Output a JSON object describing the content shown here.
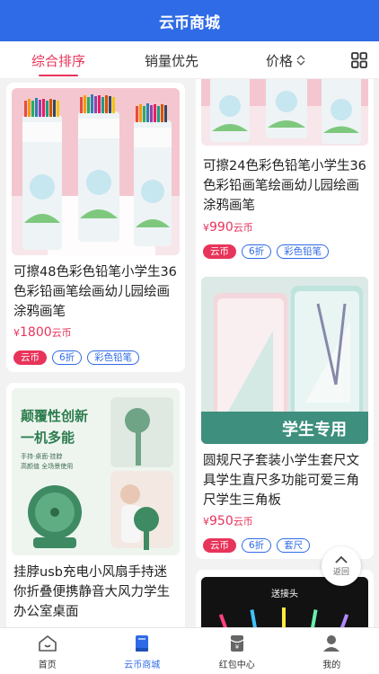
{
  "header": {
    "title": "云币商城"
  },
  "tabs": [
    {
      "label": "综合排序",
      "active": true
    },
    {
      "label": "销量优先",
      "active": false
    },
    {
      "label": "价格",
      "active": false
    }
  ],
  "grid_toggle_icon": "grid-icon",
  "products": [
    {
      "title": "可擦48色彩色铅笔小学生36色彩铅画笔绘画幼儿园绘画涂鸦画笔",
      "price_symbol": "¥",
      "price": "1800",
      "price_unit": "云币",
      "tags": [
        "云币",
        "6折",
        "彩色铅笔"
      ]
    },
    {
      "title": "可擦24色彩色铅笔小学生36色彩铅画笔绘画幼儿园绘画涂鸦画笔",
      "price_symbol": "¥",
      "price": "990",
      "price_unit": "云币",
      "tags": [
        "云币",
        "6折",
        "彩色铅笔"
      ]
    },
    {
      "title": "挂脖usb充电小风扇手持迷你折叠便携静音大风力学生办公室桌面",
      "price_symbol": "¥",
      "price": "",
      "price_unit": "",
      "tags": [],
      "image_text": {
        "line1": "颠覆性创新",
        "line2": "一机多能",
        "line3": "手持·桌面·挂脖",
        "line4": "高颜值 全场景使用"
      }
    },
    {
      "title": "圆规尺子套装小学生套尺文具学生直尺多功能可爱三角尺学生三角板",
      "price_symbol": "¥",
      "price": "950",
      "price_unit": "云币",
      "tags": [
        "云币",
        "6折",
        "套尺"
      ],
      "image_text": {
        "banner": "学生专用"
      }
    },
    {
      "image_text": {
        "banner": "送接头"
      }
    }
  ],
  "back_to_top": {
    "label": "返回"
  },
  "bottom_nav": [
    {
      "label": "首页",
      "icon": "home-icon",
      "active": false
    },
    {
      "label": "云币商城",
      "icon": "book-icon",
      "active": true
    },
    {
      "label": "红包中心",
      "icon": "red-packet-icon",
      "active": false
    },
    {
      "label": "我的",
      "icon": "user-icon",
      "active": false
    }
  ],
  "colors": {
    "brand": "#2f6be6",
    "accent": "#e8345a"
  }
}
